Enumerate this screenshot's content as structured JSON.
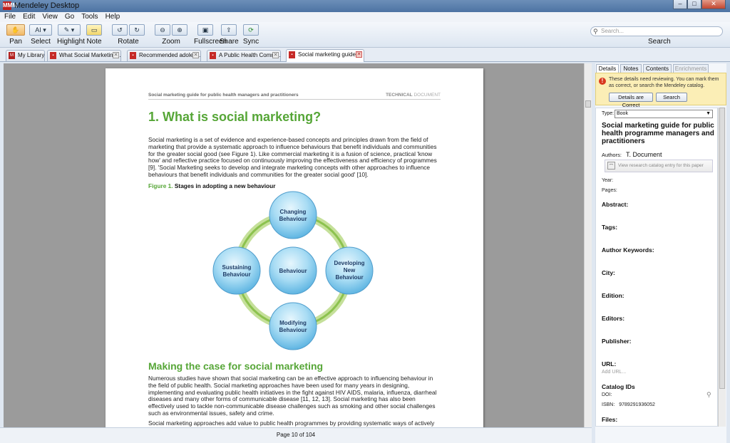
{
  "window": {
    "title": "Mendeley Desktop",
    "app_icon": "MMM"
  },
  "menu": [
    "File",
    "Edit",
    "View",
    "Go",
    "Tools",
    "Help"
  ],
  "toolbar": {
    "pan": "Pan",
    "select": "Select",
    "highlight": "Highlight",
    "note": "Note",
    "rotate": "Rotate",
    "zoom": "Zoom",
    "fullscreen": "Fullscreen",
    "share": "Share",
    "sync": "Sync",
    "select_icon": "AI"
  },
  "search": {
    "placeholder": "Search...",
    "label": "Search"
  },
  "tabs": [
    {
      "label": "My Library"
    },
    {
      "label": "What Social Marketing ..."
    },
    {
      "label": "Recommended adolesc..."
    },
    {
      "label": "A Public Health Commu..."
    },
    {
      "label": "Social marketing guide ..."
    }
  ],
  "document": {
    "running_head_left": "Social marketing guide for public health managers and practitioners",
    "running_head_right_a": "TECHNICAL",
    "running_head_right_b": "DOCUMENT",
    "heading1": "1. What is social marketing?",
    "para1": "Social marketing is a set of evidence and experience-based concepts and principles drawn from the field of marketing that provide a systematic approach to influence behaviours that benefit individuals and communities for the greater social good (see Figure 1). Like commercial marketing it is a fusion of science, practical 'know how' and reflective practice focused on continuously improving the effectiveness and efficiency of programmes [9]. 'Social Marketing seeks to develop and integrate marketing concepts with other approaches to influence behaviours that benefit individuals and communities for the greater social good' [10].",
    "figure_label": "Figure 1.",
    "figure_caption": "Stages in adopting a new behaviour",
    "diagram": {
      "top_1": "Changing",
      "top_2": "Behaviour",
      "left_1": "Sustaining",
      "left_2": "Behaviour",
      "center": "Behaviour",
      "right_1": "Developing",
      "right_2": "New",
      "right_3": "Behaviour",
      "bottom_1": "Modifying",
      "bottom_2": "Behaviour"
    },
    "heading2": "Making the case for social marketing",
    "para2": "Numerous studies have shown that social marketing can be an effective approach to influencing behaviour in the field of public health. Social marketing approaches have been used for many years in designing, implementing and evaluating public health initiatives in the fight against HIV AIDS, malaria, influenza, diarrheal diseases and many other forms of communicable disease [11, 12, 13]. Social marketing has also been effectively used to tackle non-communicable disease challenges such as smoking and other social challenges such as environmental issues, safety and crime.",
    "para3": "Social marketing approaches add value to public health programmes by providing systematic ways of actively"
  },
  "status": {
    "page": "Page 10 of 104"
  },
  "panel": {
    "tabs": {
      "details": "Details",
      "notes": "Notes",
      "contents": "Contents",
      "enrichments": "Enrichments"
    },
    "notice": "These details need reviewing. You can mark them as correct, or search the Mendeley catalog.",
    "btn_correct": "Details are Correct",
    "btn_search": "Search",
    "type_label": "Type:",
    "type_value": "Book",
    "title": "Social marketing guide for public health programme managers and practitioners",
    "authors_label": "Authors:",
    "authors_value": "T. Document",
    "catalog_link": "View research catalog entry for this paper",
    "year_label": "Year:",
    "pages_label": "Pages:",
    "abstract": "Abstract:",
    "tags": "Tags:",
    "author_keywords": "Author Keywords:",
    "city": "City:",
    "edition": "Edition:",
    "editors": "Editors:",
    "publisher": "Publisher:",
    "url": "URL:",
    "add_url": "Add URL...",
    "catalog_ids": "Catalog IDs",
    "doi_label": "DOI:",
    "isbn_label": "ISBN:",
    "isbn_value": "9789291936052",
    "files": "Files:"
  },
  "colors": {
    "accent_green": "#56a637",
    "circle_blue": "#8dcdee",
    "ring_green": "#9bc95b"
  }
}
